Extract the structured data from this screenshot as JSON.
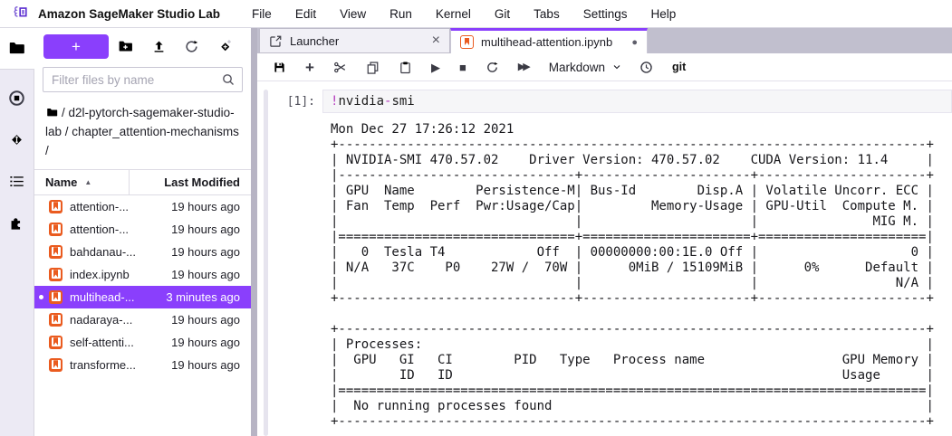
{
  "menu": {
    "app_title": "Amazon SageMaker Studio Lab",
    "items": [
      "File",
      "Edit",
      "View",
      "Run",
      "Kernel",
      "Git",
      "Tabs",
      "Settings",
      "Help"
    ]
  },
  "icons_text": {
    "plus": "+",
    "play": "▶",
    "stop_square": "■",
    "fast_forward": "▶▶",
    "close": "×",
    "sort_caret": "▲",
    "dirty_dot": "●"
  },
  "file_browser": {
    "filter_placeholder": "Filter files by name",
    "breadcrumb": "/ d2l-pytorch-sagemaker-studio-lab / chapter_attention-mechanisms /",
    "columns": {
      "name": "Name",
      "modified": "Last Modified"
    },
    "files": [
      {
        "name": "attention-...",
        "modified": "19 hours ago"
      },
      {
        "name": "attention-...",
        "modified": "19 hours ago"
      },
      {
        "name": "bahdanau-...",
        "modified": "19 hours ago"
      },
      {
        "name": "index.ipynb",
        "modified": "19 hours ago"
      },
      {
        "name": "multihead-...",
        "modified": "3 minutes ago"
      },
      {
        "name": "nadaraya-...",
        "modified": "19 hours ago"
      },
      {
        "name": "self-attenti...",
        "modified": "19 hours ago"
      },
      {
        "name": "transforme...",
        "modified": "19 hours ago"
      }
    ]
  },
  "tabs": [
    {
      "label": "Launcher"
    },
    {
      "label": "multihead-attention.ipynb"
    }
  ],
  "nb_toolbar": {
    "cell_type": "Markdown",
    "git_label": "git"
  },
  "notebook": {
    "prompt": "[1]:",
    "code": {
      "bang": "!",
      "word1": "nvidia",
      "dash": "-",
      "word2": "smi"
    },
    "output": "Mon Dec 27 17:26:12 2021\n+-----------------------------------------------------------------------------+\n| NVIDIA-SMI 470.57.02    Driver Version: 470.57.02    CUDA Version: 11.4     |\n|-------------------------------+----------------------+----------------------+\n| GPU  Name        Persistence-M| Bus-Id        Disp.A | Volatile Uncorr. ECC |\n| Fan  Temp  Perf  Pwr:Usage/Cap|         Memory-Usage | GPU-Util  Compute M. |\n|                               |                      |               MIG M. |\n|===============================+======================+======================|\n|   0  Tesla T4            Off  | 00000000:00:1E.0 Off |                    0 |\n| N/A   37C    P0    27W /  70W |      0MiB / 15109MiB |      0%      Default |\n|                               |                      |                  N/A |\n+-------------------------------+----------------------+----------------------+\n                                                                               \n+-----------------------------------------------------------------------------+\n| Processes:                                                                  |\n|  GPU   GI   CI        PID   Type   Process name                  GPU Memory |\n|        ID   ID                                                   Usage      |\n|=============================================================================|\n|  No running processes found                                                 |\n+-----------------------------------------------------------------------------+"
  },
  "colors": {
    "accent": "#8A3FFC",
    "notebook_icon": "#EA5B1F",
    "tabbar_bg": "#C1BFCE"
  }
}
